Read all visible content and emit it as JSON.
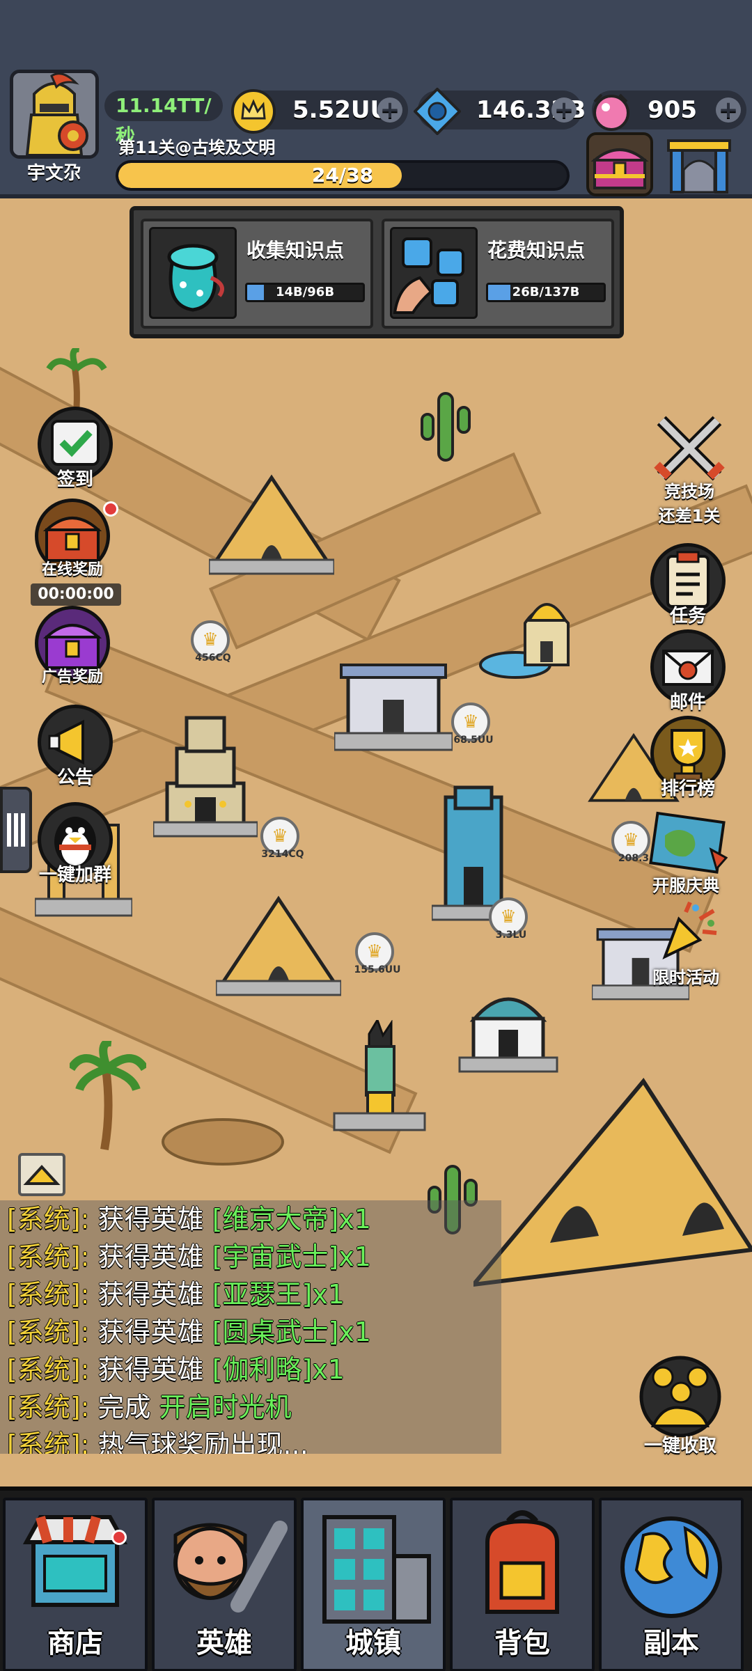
{
  "player": {
    "name": "宇文尕",
    "income": "11.14TT/秒"
  },
  "level": {
    "text": "第11关@古埃及文明",
    "progress_text": "24/38",
    "progress_fraction": 0.6316
  },
  "resources": [
    {
      "name": "crown",
      "value": "5.52UU",
      "icon": "crown-coin-icon"
    },
    {
      "name": "gem",
      "value": "146.32B",
      "icon": "blue-gem-icon"
    },
    {
      "name": "candy",
      "value": "905",
      "icon": "candy-icon"
    }
  ],
  "knowledge": {
    "collect": {
      "title": "收集知识点",
      "value": "14B/96B",
      "fraction": 0.146
    },
    "spend": {
      "title": "花费知识点",
      "value": "26B/137B",
      "fraction": 0.19
    }
  },
  "left_buttons": {
    "checkin": "签到",
    "online_reward": "在线奖励",
    "timer": "00:00:00",
    "ad_reward": "广告奖励",
    "notice": "公告",
    "join_group": "一键加群"
  },
  "right_buttons": {
    "arena": "竞技场",
    "arena_sub": "还差1关",
    "tasks": "任务",
    "mail": "邮件",
    "ranking": "排行榜",
    "celebration": "开服庆典",
    "limited_event": "限时活动",
    "collect_all": "一键收取"
  },
  "badges": [
    "456CQ",
    "68.5UU",
    "3214CQ",
    "3.3LU",
    "155.6UU",
    "208.3"
  ],
  "chat": [
    {
      "tag": "[系统]:",
      "text": " 获得英雄 ",
      "highlight": "[维京大帝]x1"
    },
    {
      "tag": "[系统]:",
      "text": " 获得英雄 ",
      "highlight": "[宇宙武士]x1"
    },
    {
      "tag": "[系统]:",
      "text": " 获得英雄 ",
      "highlight": "[亚瑟王]x1"
    },
    {
      "tag": "[系统]:",
      "text": " 获得英雄 ",
      "highlight": "[圆桌武士]x1"
    },
    {
      "tag": "[系统]:",
      "text": " 获得英雄 ",
      "highlight": "[伽利略]x1"
    },
    {
      "tag": "[系统]:",
      "text": " 完成 ",
      "highlight": "开启时光机"
    },
    {
      "tag": "[系统]:",
      "text": " 热气球奖励出现...",
      "highlight": ""
    }
  ],
  "nav": [
    {
      "label": "商店",
      "icon": "shop-icon"
    },
    {
      "label": "英雄",
      "icon": "caveman-hero-icon"
    },
    {
      "label": "城镇",
      "icon": "town-building-icon"
    },
    {
      "label": "背包",
      "icon": "backpack-icon"
    },
    {
      "label": "副本",
      "icon": "globe-icon"
    }
  ],
  "colors": {
    "topbar": "#3d4658",
    "sand": "#d9b07a",
    "road": "#c89b63",
    "progress": "#f7c44c",
    "chat_tag": "#f3d23a",
    "chat_highlight": "#6af05a"
  }
}
